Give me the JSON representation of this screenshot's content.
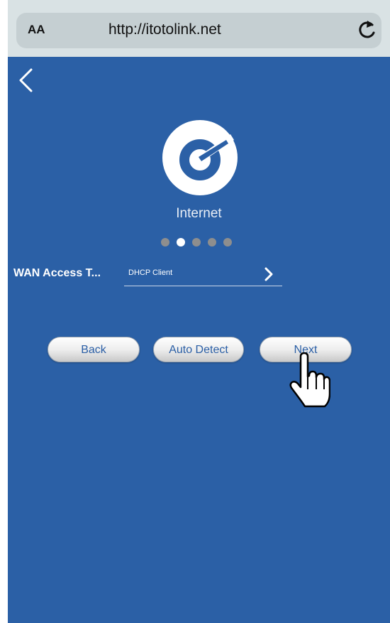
{
  "browser": {
    "text_size_label": "AA",
    "url": "http://itotolink.net"
  },
  "page": {
    "section_title": "Internet",
    "step_dots": {
      "total": 5,
      "active_index": 1
    }
  },
  "wan": {
    "label": "WAN Access T...",
    "value": "DHCP Client"
  },
  "buttons": {
    "back": "Back",
    "auto_detect": "Auto Detect",
    "next": "Next"
  },
  "colors": {
    "background": "#2b60a6",
    "button_text": "#2a5ea5",
    "dot_active": "#ffffff",
    "dot_inactive": "#8e8e8e"
  },
  "icons": {
    "browser_reload": "reload-icon",
    "nav_back": "chevron-left-icon",
    "logo": "internet-logo-icon",
    "wan_select": "chevron-right-icon",
    "pointer": "hand-cursor-icon"
  }
}
